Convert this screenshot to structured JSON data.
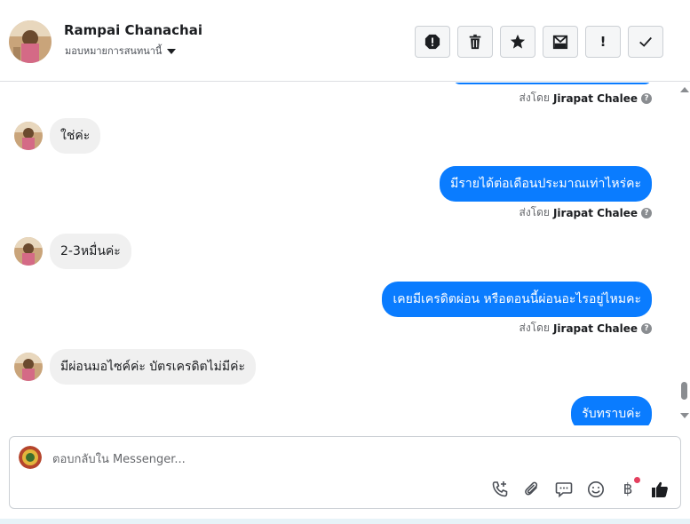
{
  "header": {
    "contact_name": "Rampai Chanachai",
    "assign_label": "มอบหมายการสนทนานี้"
  },
  "tools": [
    {
      "icon": "report-spam-icon"
    },
    {
      "icon": "trash-icon"
    },
    {
      "icon": "star-icon"
    },
    {
      "icon": "mark-unread-icon"
    },
    {
      "icon": "important-icon",
      "text": "!"
    },
    {
      "icon": "check-icon"
    }
  ],
  "messages": {
    "sent_prefix": "ส่งโดย",
    "sender": "Jirapat Chalee",
    "help": "?",
    "in_1": "ใช่ค่ะ",
    "out_1": "มีรายได้ต่อเดือนประมาณเท่าไหร่คะ",
    "in_2": "2-3หมื่นค่ะ",
    "out_2": "เคยมีเครดิตผ่อน หรือตอนนี้ผ่อนอะไรอยู่ไหมคะ",
    "in_3": "มีผ่อนมอไซค์ค่ะ บัตรเครดิตไม่มีค่ะ",
    "out_3": "รับทราบค่ะ"
  },
  "composer": {
    "placeholder": "ตอบกลับใน Messenger...",
    "baht": "฿"
  },
  "colors": {
    "outgoing": "#0a7cff",
    "incoming": "#f0f0f0",
    "notification_dot": "#e4405f"
  }
}
